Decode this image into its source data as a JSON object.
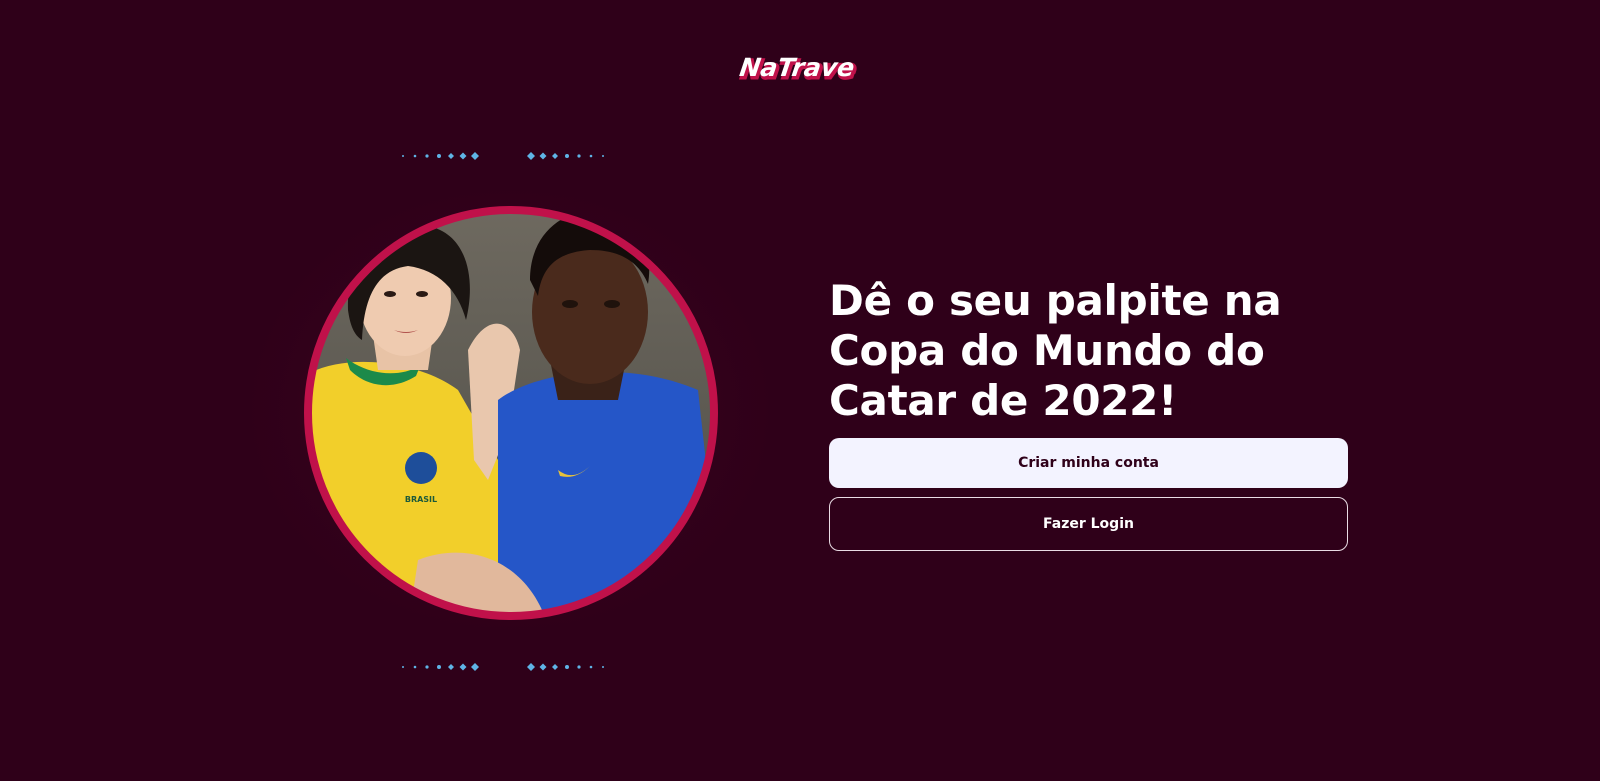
{
  "brand": {
    "logo_text": "NaTrave"
  },
  "hero": {
    "image_alt": "Dois torcedores com camisas da seleção brasileira",
    "ring_color": "#c0114a",
    "dot_color": "#5fb4e6",
    "shirt_badge": "BRASIL"
  },
  "main": {
    "headline": "Dê o seu palpite na Copa do Mundo do Catar de 2022!",
    "create_account_label": "Criar minha conta",
    "login_label": "Fazer Login"
  },
  "colors": {
    "background": "#2f0019",
    "primary_button": "#f3f3ff",
    "primary_button_text": "#2f0019",
    "accent": "#c0114a"
  }
}
